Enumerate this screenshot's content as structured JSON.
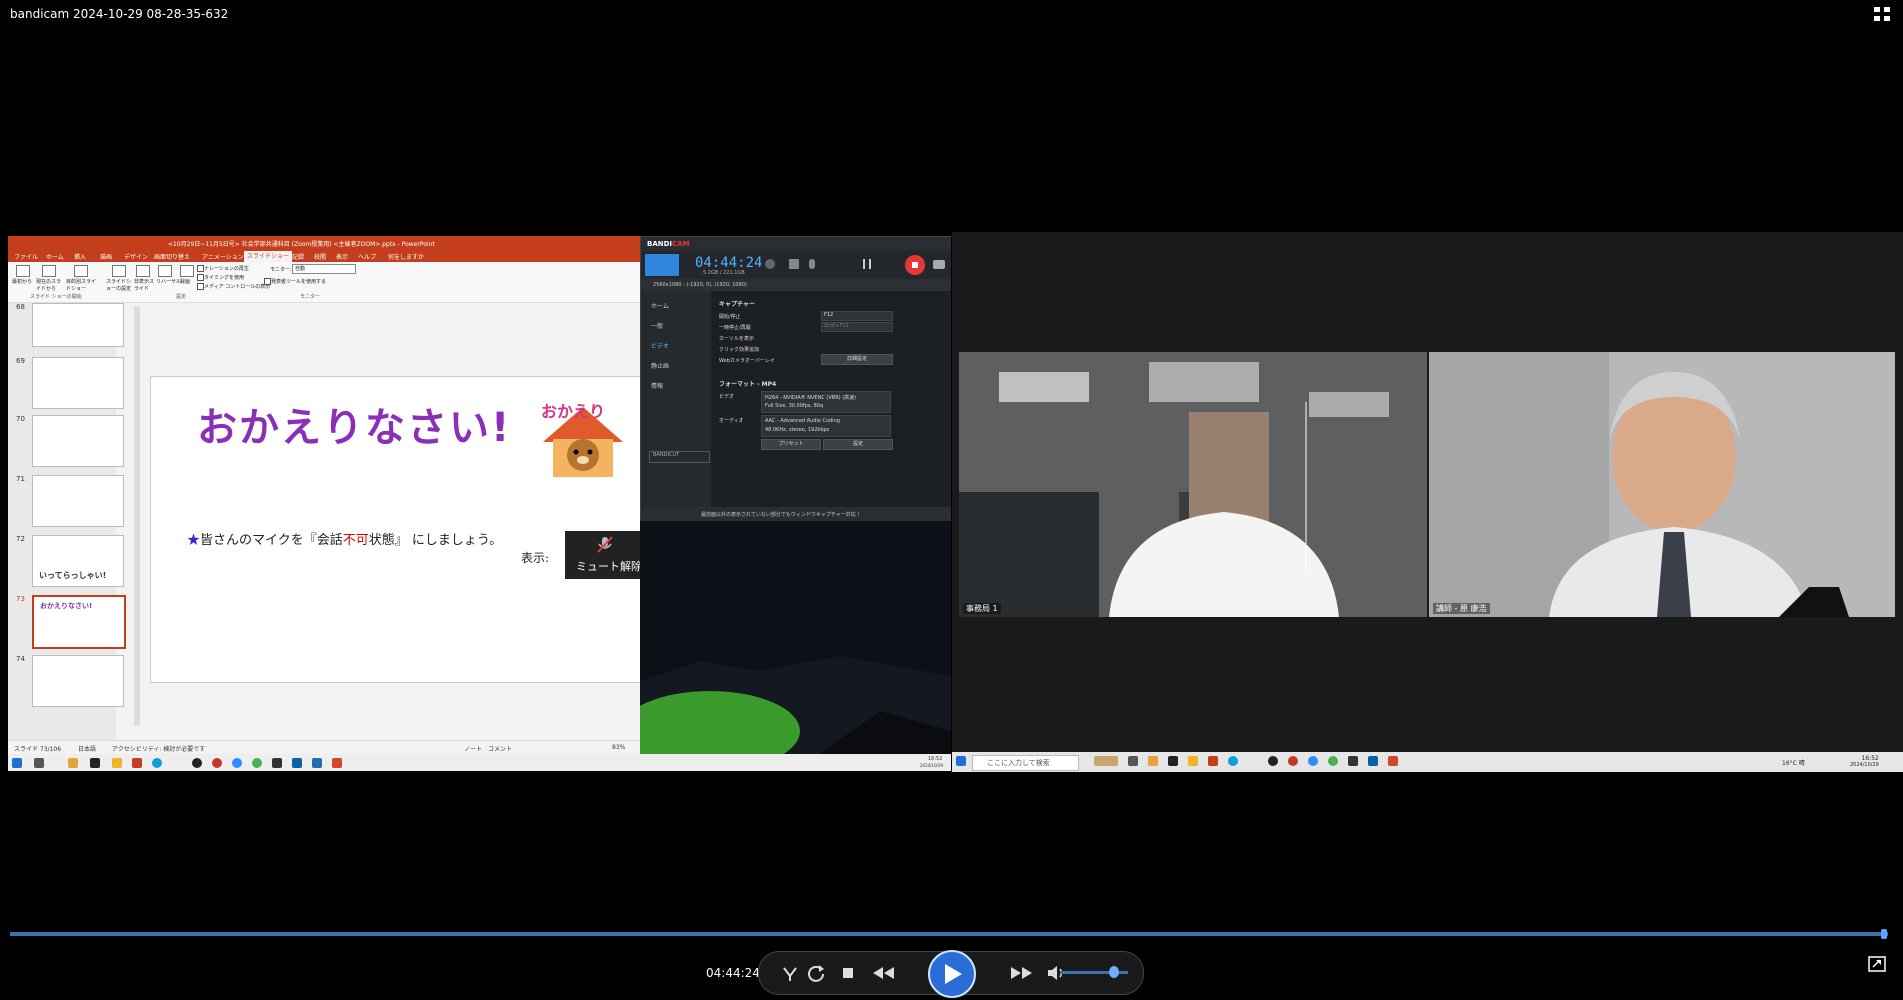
{
  "window": {
    "title": "bandicam 2024-10-29 08-28-35-632"
  },
  "ppt": {
    "title": "<10月29日~11月5日号> 社会学部共通科目 (Zoom授業用) <主催者ZOOM>.pptx - PowerPoint",
    "tabs": [
      "ファイル",
      "ホーム",
      "挿入",
      "描画",
      "デザイン",
      "画面切り替え",
      "アニメーション",
      "スライドショー",
      "記録",
      "校閲",
      "表示",
      "ヘルプ",
      "何をしますか"
    ],
    "ribbon": {
      "items": [
        "最初から",
        "現在のスライドから",
        "目的別スライドショー",
        "スライドショーの設定",
        "非表示スライド",
        "リハーサル",
        "録画"
      ],
      "checks": [
        "ナレーションの再生",
        "タイミングを使用",
        "メディア コントロールの表示"
      ],
      "presenter_tool": "発表者ツールを使用する",
      "monitor_label": "モニター:",
      "monitor_value": "自動",
      "group1": "スライド ショーの開始",
      "group2": "設定",
      "group3": "モニター"
    },
    "thumbs": [
      "68",
      "69",
      "70",
      "71",
      "72",
      "73",
      "74"
    ],
    "thumb72_text": "いってらっしゃい!",
    "thumb73_text": "おかえりなさい!",
    "slide": {
      "title": "おかえりなさい!",
      "logo_text": "おかえり",
      "star": "★",
      "text_pre": "皆さんのマイクを『会話",
      "text_red": "不可",
      "text_post": "状態』 にしましょう。",
      "display_label": "表示:",
      "mute_button": "ミュート解除"
    },
    "status": {
      "slide": "スライド 73/106",
      "lang": "日本語",
      "accessibility": "アクセシビリティ: 検討が必要です",
      "notes": "ノート",
      "comments": "コメント",
      "zoom": "83%"
    }
  },
  "bandicam": {
    "logo1": "BANDI",
    "logo2": "CAM",
    "timer": "04:44:24",
    "size": "5.2GB / 221.1GB",
    "resolution": "2560x1080 - (-1920, 0), (1920, 1080)",
    "side": [
      "ホーム",
      "一般",
      "ビデオ",
      "静止画",
      "情報"
    ],
    "capture_header": "キャプチャー",
    "checks": [
      "開始/停止",
      "一時停止/再開",
      "カーソルを表示",
      "クリック効果追加",
      "Webカメラオーバーレイ"
    ],
    "hotkey1": "F12",
    "hotkey2": "Shift+F12",
    "detail_btn": "詳細設定",
    "format_header": "フォーマット - MP4",
    "video_label": "ビデオ",
    "video_line1": "H264 - NVIDIA® NVENC (VBR) (高速)",
    "video_line2": "Full Size, 30.00fps, 80q",
    "audio_label": "オーディオ",
    "audio_line1": "AAC - Advanced Audio Coding",
    "audio_line2": "48.0KHz, stereo, 192kbps",
    "preset_btn": "プリセット",
    "settings_btn": "設定",
    "footer": "最前面以外の表示されていない部分でもウィンドウキャプチャー対応 !",
    "brand_small": "BANDICUT"
  },
  "zoom": {
    "tile1_name": "事務局 1",
    "tile2_name": "講師 - 原 康浩"
  },
  "taskbar_right": {
    "search": "ここに入力して検索",
    "temp": "16°C 晴",
    "time": "16:52",
    "date": "2024/10/29"
  },
  "taskbar_left": {
    "time": "16:52",
    "date": "2024/10/29"
  },
  "player": {
    "time": "04:44:24",
    "progress": 0.998,
    "volume": 0.8
  },
  "colors": {
    "ppt_accent": "#c43e1c",
    "zoom_bg": "#1a1a1a",
    "player_blue": "#2b6cd6"
  }
}
